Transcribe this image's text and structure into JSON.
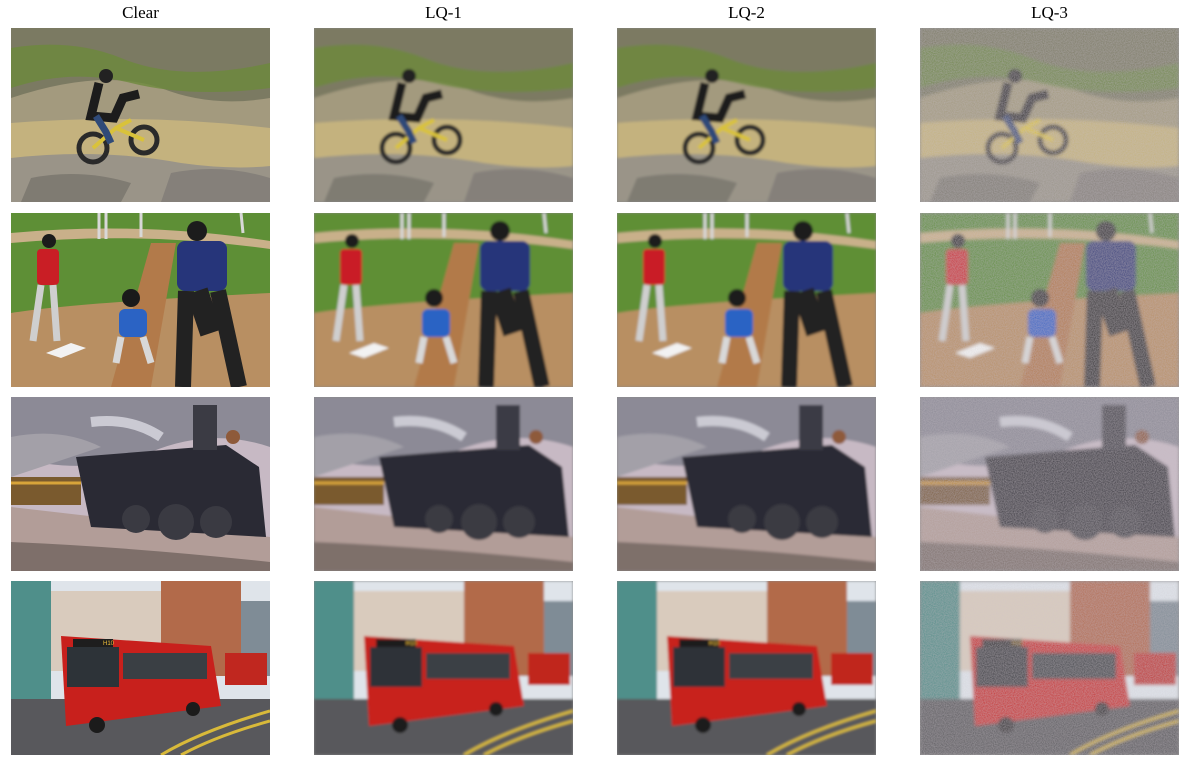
{
  "columns": [
    {
      "id": "clear",
      "label": "Clear"
    },
    {
      "id": "lq-1",
      "label": "LQ-1"
    },
    {
      "id": "lq-2",
      "label": "LQ-2"
    },
    {
      "id": "lq-3",
      "label": "LQ-3"
    }
  ],
  "rows": [
    {
      "id": "motorbike",
      "subject": "dirt-bike-rider"
    },
    {
      "id": "baseball",
      "subject": "baseball-batter-catcher-umpire"
    },
    {
      "id": "train",
      "subject": "steam-locomotive"
    },
    {
      "id": "bus",
      "subject": "red-bus-street"
    }
  ],
  "colors": {
    "grass": "#6f9a3a",
    "dirt": "#b89a6a",
    "rock": "#8a8478",
    "bus_red": "#c8201c",
    "sky": "#dfe4ea"
  }
}
